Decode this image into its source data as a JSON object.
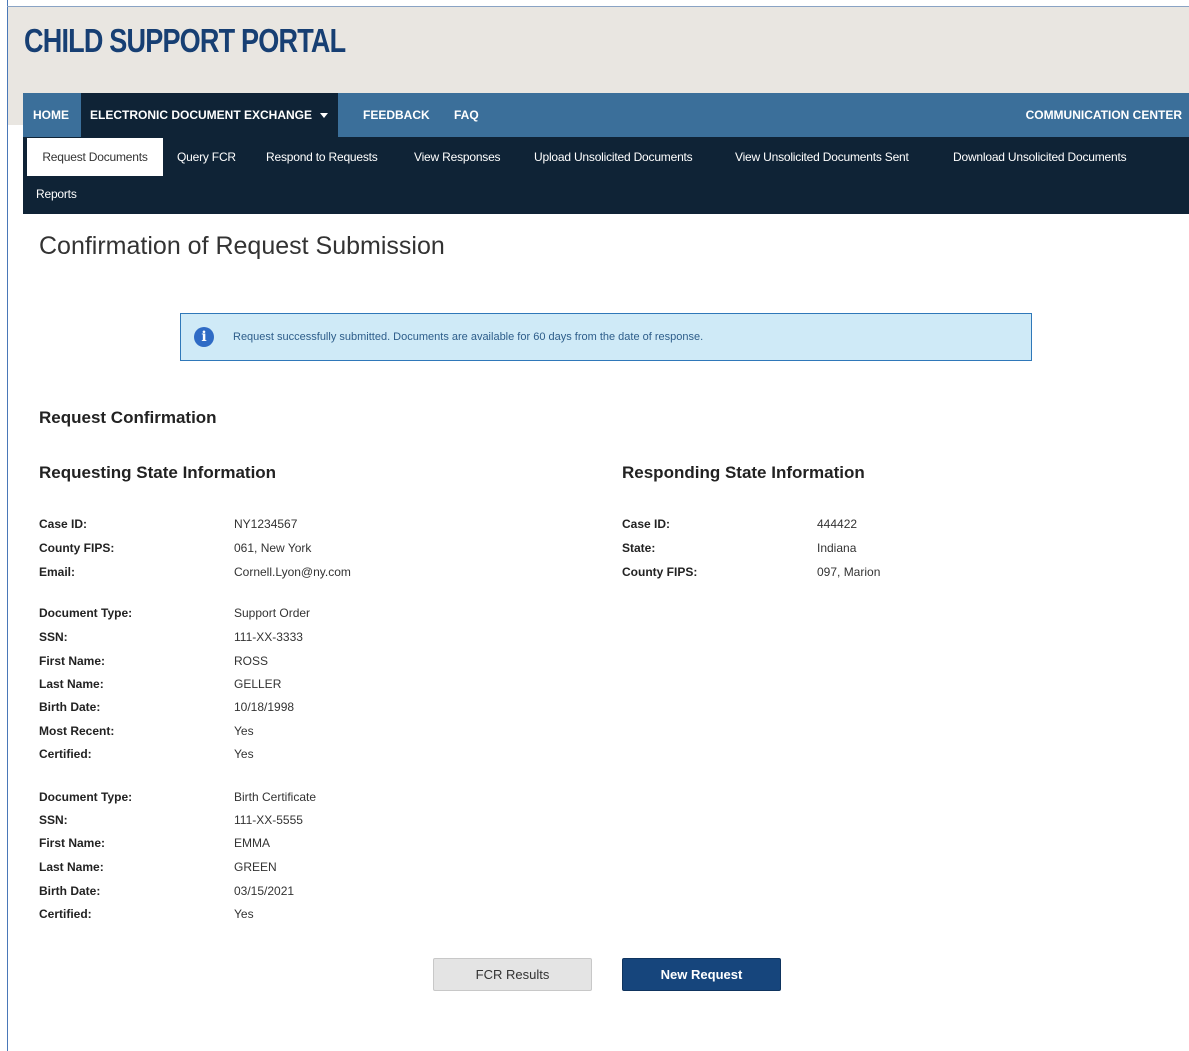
{
  "app": {
    "logo_text": "CHILD SUPPORT PORTAL"
  },
  "topnav": {
    "home": "HOME",
    "ede": "ELECTRONIC DOCUMENT EXCHANGE",
    "feedback": "FEEDBACK",
    "faq": "FAQ",
    "comm": "COMMUNICATION CENTER"
  },
  "subnav": {
    "items": [
      "Request Documents",
      "Query FCR",
      "Respond to Requests",
      "View Responses",
      "Upload Unsolicited Documents",
      "View Unsolicited Documents Sent",
      "Download Unsolicited Documents",
      "Reports"
    ],
    "active": "Request Documents"
  },
  "page": {
    "title": "Confirmation of Request Submission"
  },
  "alert": {
    "icon": "info-icon",
    "message": "Request successfully submitted. Documents are available for 60 days from the date of response."
  },
  "confirmation": {
    "heading": "Request Confirmation",
    "requesting": {
      "heading": "Requesting State Information",
      "rows": [
        {
          "label": "Case ID:",
          "value": "NY1234567"
        },
        {
          "label": "County FIPS:",
          "value": "061, New York"
        },
        {
          "label": "Email:",
          "value": "Cornell.Lyon@ny.com"
        }
      ],
      "documents": [
        {
          "rows": [
            {
              "label": "Document Type:",
              "value": "Support Order"
            },
            {
              "label": "SSN:",
              "value": "111-XX-3333"
            },
            {
              "label": "First Name:",
              "value": "ROSS"
            },
            {
              "label": "Last Name:",
              "value": "GELLER"
            },
            {
              "label": "Birth Date:",
              "value": "10/18/1998"
            },
            {
              "label": "Most Recent:",
              "value": "Yes"
            },
            {
              "label": "Certified:",
              "value": "Yes"
            }
          ]
        },
        {
          "rows": [
            {
              "label": "Document Type:",
              "value": "Birth Certificate"
            },
            {
              "label": "SSN:",
              "value": "111-XX-5555"
            },
            {
              "label": "First Name:",
              "value": "EMMA"
            },
            {
              "label": "Last Name:",
              "value": "GREEN"
            },
            {
              "label": "Birth Date:",
              "value": "03/15/2021"
            },
            {
              "label": "Certified:",
              "value": "Yes"
            }
          ]
        }
      ]
    },
    "responding": {
      "heading": "Responding State Information",
      "rows": [
        {
          "label": "Case ID:",
          "value": "444422"
        },
        {
          "label": "State:",
          "value": "Indiana"
        },
        {
          "label": "County FIPS:",
          "value": "097, Marion"
        }
      ]
    }
  },
  "buttons": {
    "fcr_results": "FCR Results",
    "new_request": "New Request"
  },
  "colors": {
    "nav": "#3b6f9a",
    "subnav": "#0f2336",
    "primary": "#16457c",
    "alert_bg": "#cfeaf7"
  }
}
